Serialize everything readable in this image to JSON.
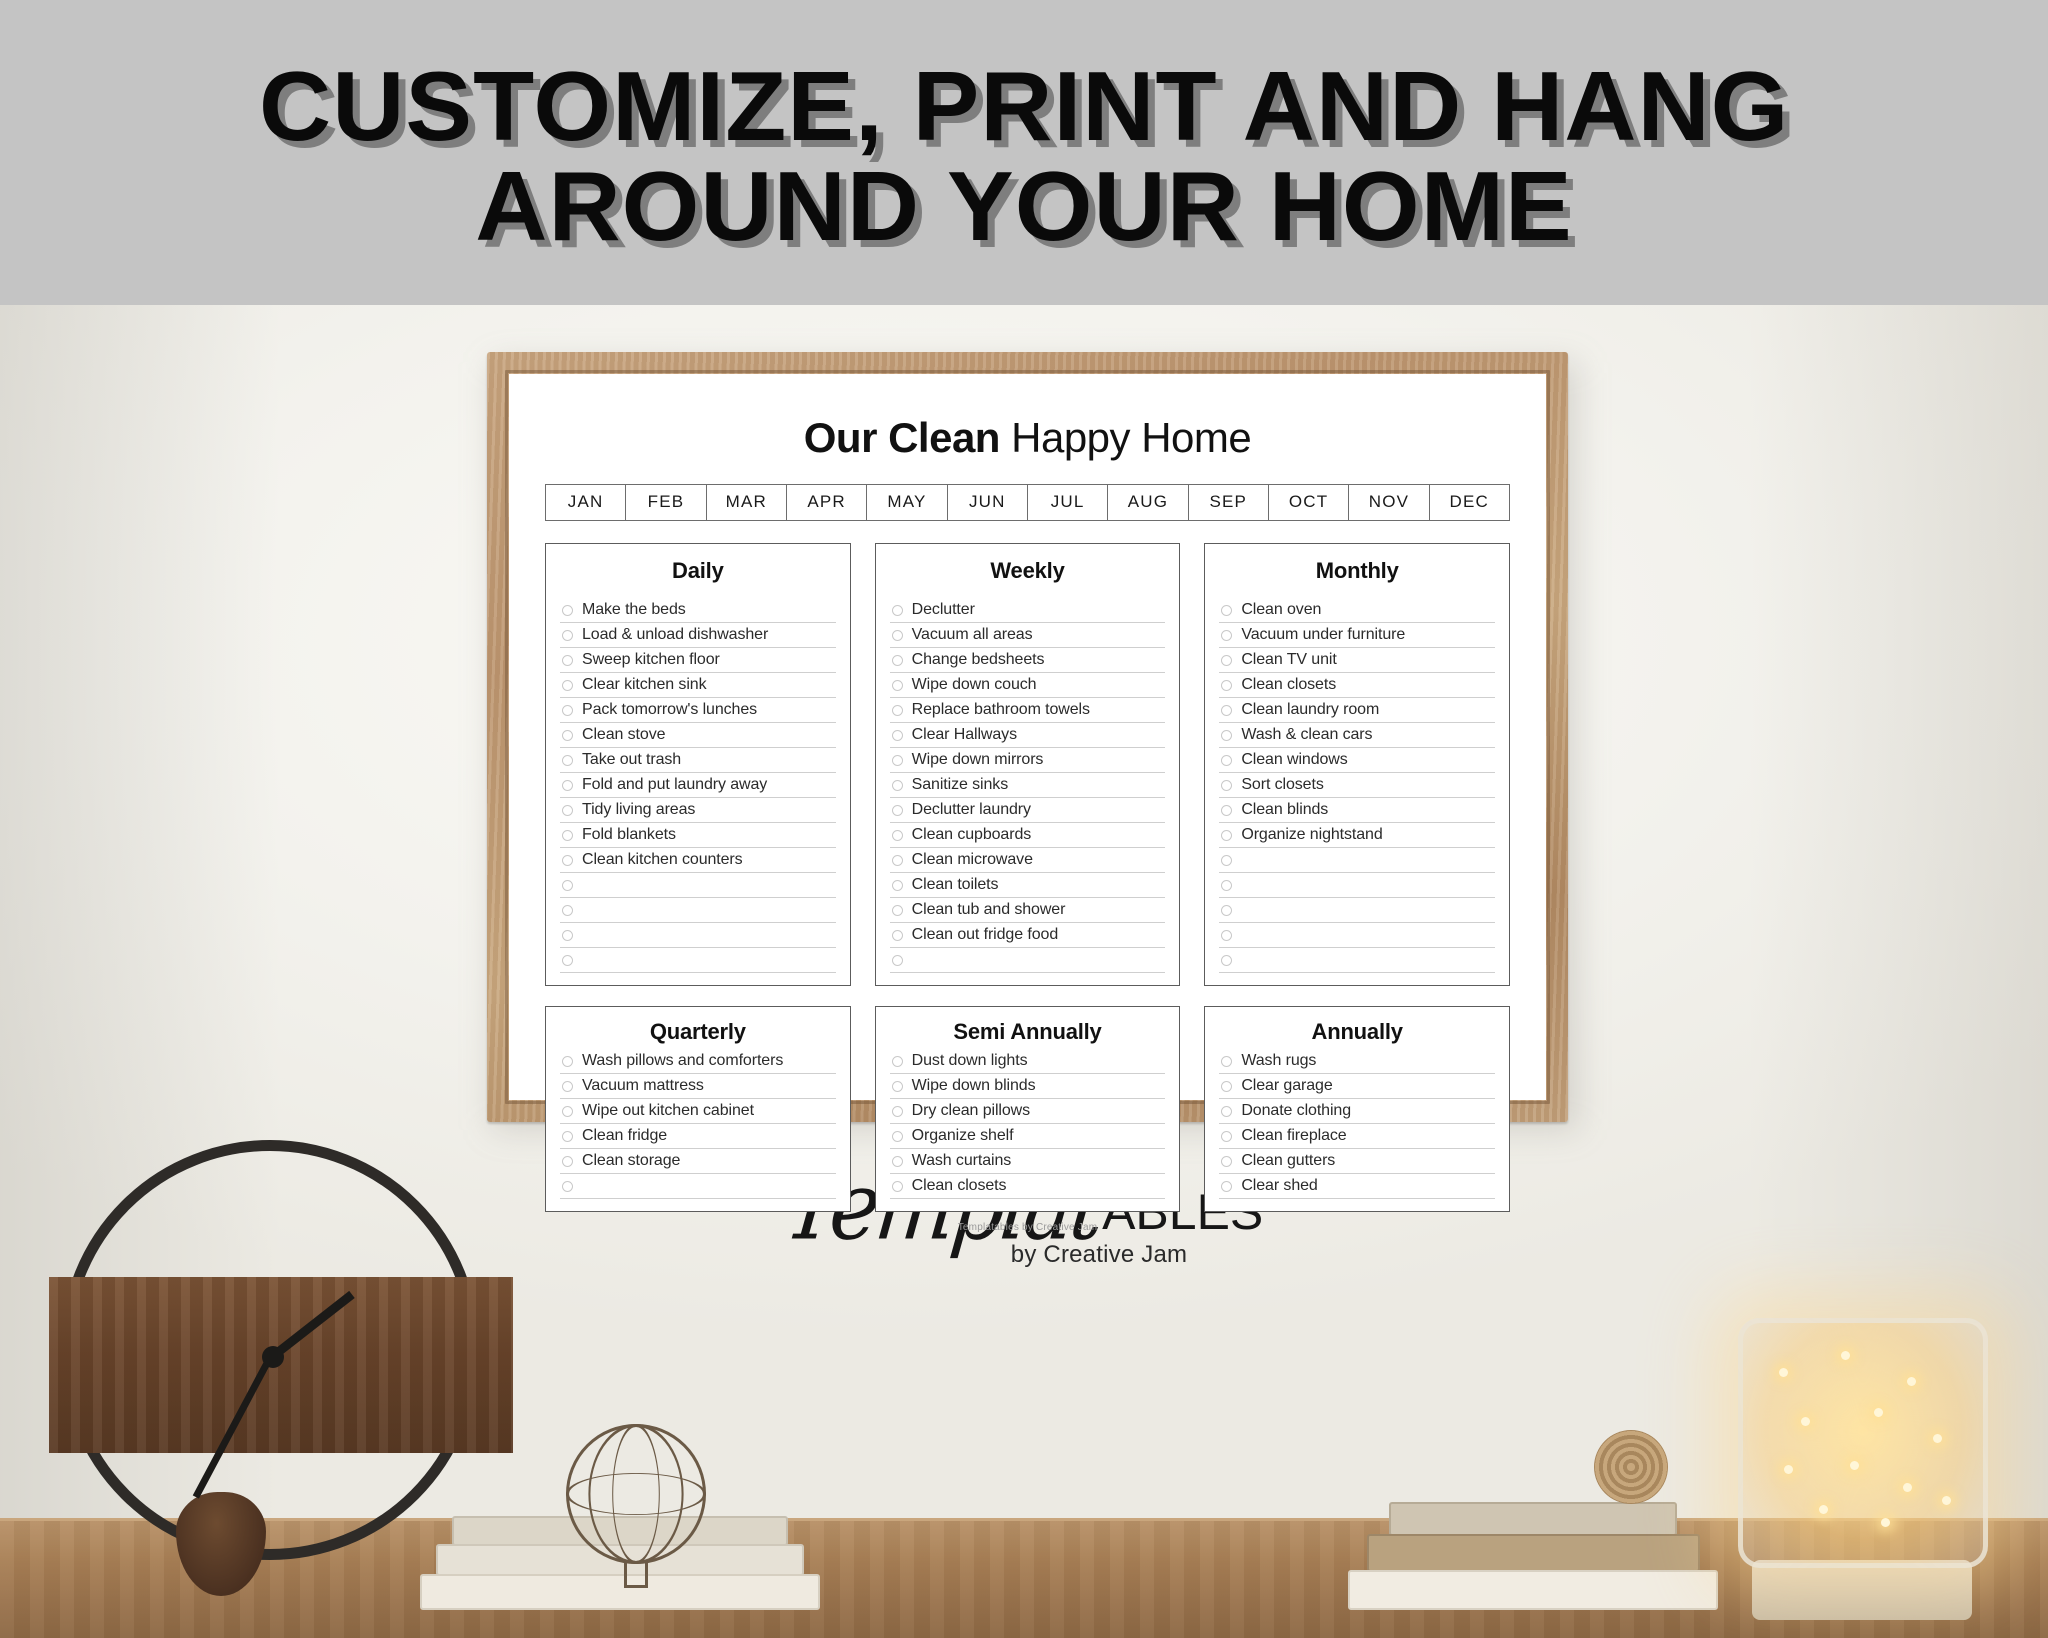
{
  "banner": {
    "line1": "CUSTOMIZE, PRINT AND HANG",
    "line2": "AROUND YOUR HOME",
    "bg_color": "#c4c4c4",
    "text_color": "#0a0a0a"
  },
  "poster": {
    "title_bold": "Our Clean",
    "title_regular": " Happy Home",
    "months": [
      "JAN",
      "FEB",
      "MAR",
      "APR",
      "MAY",
      "JUN",
      "JUL",
      "AUG",
      "SEP",
      "OCT",
      "NOV",
      "DEC"
    ],
    "footer": "Templatables by Creative Jam",
    "sections": [
      {
        "title": "Daily",
        "tasks": [
          "Make the beds",
          "Load & unload dishwasher",
          "Sweep kitchen floor",
          "Clear kitchen sink",
          "Pack tomorrow's lunches",
          "Clean stove",
          "Take out trash",
          "Fold and put laundry away",
          "Tidy living areas",
          "Fold blankets",
          "Clean kitchen counters"
        ],
        "blank_rows": 4
      },
      {
        "title": "Weekly",
        "tasks": [
          "Declutter",
          "Vacuum all areas",
          "Change bedsheets",
          "Wipe down couch",
          "Replace bathroom towels",
          "Clear Hallways",
          "Wipe down mirrors",
          "Sanitize sinks",
          "Declutter laundry",
          "Clean cupboards",
          "Clean microwave",
          "Clean toilets",
          "Clean tub and shower",
          "Clean out fridge food"
        ],
        "blank_rows": 1
      },
      {
        "title": "Monthly",
        "tasks": [
          "Clean oven",
          "Vacuum under furniture",
          "Clean TV unit",
          "Clean closets",
          "Clean laundry room",
          "Wash & clean cars",
          "Clean windows",
          "Sort closets",
          "Clean blinds",
          "Organize nightstand"
        ],
        "blank_rows": 5
      },
      {
        "title": "Quarterly",
        "tasks": [
          "Wash pillows and comforters",
          "Vacuum mattress",
          "Wipe out kitchen cabinet",
          "Clean fridge",
          "Clean storage"
        ],
        "blank_rows": 1
      },
      {
        "title": "Semi Annually",
        "tasks": [
          "Dust down lights",
          "Wipe down blinds",
          "Dry clean pillows",
          "Organize shelf",
          "Wash curtains",
          "Clean closets"
        ],
        "blank_rows": 0
      },
      {
        "title": "Annually",
        "tasks": [
          "Wash rugs",
          "Clear garage",
          "Donate clothing",
          "Clean fireplace",
          "Clean gutters",
          "Clear shed"
        ],
        "blank_rows": 0
      }
    ]
  },
  "brand": {
    "script": "Templat",
    "sans": "ABLES",
    "sub": "by Creative Jam"
  }
}
